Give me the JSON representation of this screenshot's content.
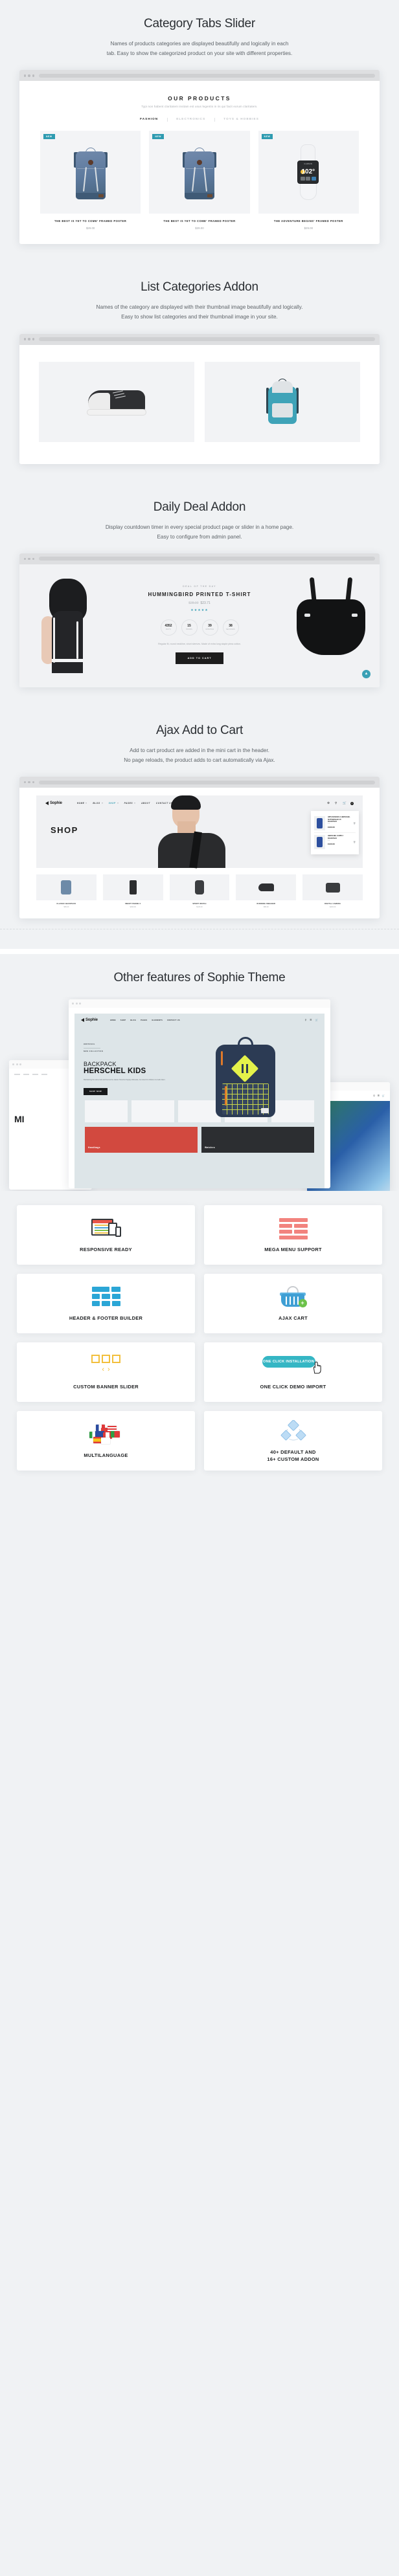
{
  "sections": [
    {
      "id": "category-tabs-slider",
      "title": "Category Tabs Slider",
      "desc_line1": "Names of products categories are displayed beautifully and logically in each",
      "desc_line2": "tab. Easy to show the categorized product on your site with different properties."
    },
    {
      "id": "list-categories-addon",
      "title": "List Categories Addon",
      "desc_line1": "Names of the category are displayed with their thumbnail image beautifully and logically.",
      "desc_line2": "Easy to show list categories and their thumbnail image in your site."
    },
    {
      "id": "daily-deal-addon",
      "title": "Daily Deal Addon",
      "desc_line1": "Display countdown timer in every special product page or slider in a home page.",
      "desc_line2": "Easy to configure from admin panel."
    },
    {
      "id": "ajax-add-to-cart",
      "title": "Ajax Add to Cart",
      "desc_line1": "Add to cart product are added in the mini cart in the header.",
      "desc_line2": "No page reloads, the product adds to cart automatically via Ajax."
    }
  ],
  "products_block": {
    "heading": "OUR PRODUCTS",
    "subheading": "Typi non habent claritatem insitam est usus legentis in iis qui facit eorum claritatem.",
    "tabs": [
      {
        "label": "FASHION",
        "active": true
      },
      {
        "label": "ELECTRONICS",
        "active": false
      },
      {
        "label": "TOYS & HOBBIES",
        "active": false
      }
    ],
    "badge": "NEW",
    "items": [
      {
        "name": "THE BEST IS YET TO COME' FRAMED POSTER",
        "price": "$29.00",
        "art": "backpack"
      },
      {
        "name": "THE BEST IS YET TO COME' FRAMED POSTER",
        "price": "$29.00",
        "art": "backpack"
      },
      {
        "name": "THE ADVENTURE BEGINS' FRAMED POSTER",
        "price": "$29.00",
        "art": "watch"
      }
    ]
  },
  "categories_block": {
    "cards": [
      {
        "art": "sneaker"
      },
      {
        "art": "backpack-teal"
      }
    ]
  },
  "daily_deal": {
    "label": "DEAL OF THE DAY",
    "product_name": "HUMMINGBIRD PRINTED T-SHIRT",
    "price_old": "$28.00",
    "price_new": "$23.71",
    "stars": "★★★★★",
    "counters": [
      {
        "num": "4352",
        "unit": "DAYS"
      },
      {
        "num": "15",
        "unit": "HOURS"
      },
      {
        "num": "39",
        "unit": "MINUTES"
      },
      {
        "num": "38",
        "unit": "SECONDS"
      }
    ],
    "description": "Regular fit, round neckline, short sleeves. Made of extra long staple pima cotton.",
    "button": "ADD TO CART",
    "scroll_top_icon": "arrow-up"
  },
  "shop_mockup": {
    "logo": "Sophie",
    "nav": [
      {
        "label": "HOME",
        "caret": true,
        "active": false
      },
      {
        "label": "BLOG",
        "caret": true,
        "active": false
      },
      {
        "label": "SHOP",
        "caret": true,
        "active": true
      },
      {
        "label": "PAGES",
        "caret": true,
        "active": false
      },
      {
        "label": "ABOUT",
        "caret": false,
        "active": false
      },
      {
        "label": "CONTACT US",
        "caret": false,
        "active": false
      }
    ],
    "icons": [
      "settings-icon",
      "search-icon",
      "cart-icon"
    ],
    "cart_count": "2",
    "hero_word": "SHOP",
    "minicart": [
      {
        "title": "HIPS DESIGNS X HERSCHEL NUTTERSACK 25 BACKPACK",
        "qty": "1 x",
        "price": "€160.00"
      },
      {
        "title": "HERSCHEL SUPPLY BACKPACK",
        "qty": "1 x",
        "price": "€120.00"
      }
    ],
    "row": [
      {
        "name": "CLASSIC BACKPACK",
        "price": "$59.00",
        "art": "bag"
      },
      {
        "name": "SMART PHONE X",
        "price": "$399.00",
        "art": "phone"
      },
      {
        "name": "SPORT WATCH",
        "price": "$129.00",
        "art": "watch"
      },
      {
        "name": "RUNNING SNEAKER",
        "price": "$89.00",
        "art": "shoe"
      },
      {
        "name": "DIGITAL CAMERA",
        "price": "$249.00",
        "art": "camera"
      }
    ]
  },
  "other_features": {
    "title": "Other features of Sophie Theme",
    "hero": {
      "logo": "Sophie",
      "nav": [
        "HOME",
        "SHOP",
        "BLOG",
        "PAGES",
        "ELEMENTS",
        "CONTACT US"
      ],
      "kicker_line1": "HERSCHEL",
      "kicker_line2": "NEW COLLECTION",
      "h1": "BACKPACK",
      "h2": "HERSCHEL KIDS",
      "paragraph": "Maintaining the same look and feel as the classic Herschel Supply silhouette, but sized for children & small orders.",
      "button": "SHOP NOW",
      "band_left": "Handbags",
      "band_right": "Watches"
    },
    "left_window_word": "MI",
    "cards": [
      {
        "label": "RESPONSIVE READY",
        "icon": "responsive-icon"
      },
      {
        "label": "MEGA MENU SUPPORT",
        "icon": "mega-menu-icon"
      },
      {
        "label": "HEADER & FOOTER BUILDER",
        "icon": "layout-builder-icon"
      },
      {
        "label": "AJAX CART",
        "icon": "shopping-basket-icon"
      },
      {
        "label": "CUSTOM BANNER SLIDER",
        "icon": "banner-slider-icon"
      },
      {
        "label": "ONE CLICK DEMO IMPORT",
        "icon": "one-click-install-icon",
        "badge": "ONE CLICK INSTALLATION"
      },
      {
        "label": "MULTILANGUAGE",
        "icon": "flags-icon"
      },
      {
        "label": "40+ DEFAULT AND\n16+ CUSTOM ADDON",
        "label_line1": "40+ DEFAULT AND",
        "label_line2": "16+ CUSTOM ADDON",
        "icon": "addon-cubes-icon"
      }
    ]
  },
  "colors": {
    "page_bg": "#f0f2f4",
    "accent_teal": "#35b6c4",
    "badge_teal": "#2e9bb0",
    "yellow": "#f2bf3c",
    "blue": "#2ba6d6",
    "red": "#f2837e",
    "green": "#6cc24a",
    "dark": "#1d1d1d"
  }
}
